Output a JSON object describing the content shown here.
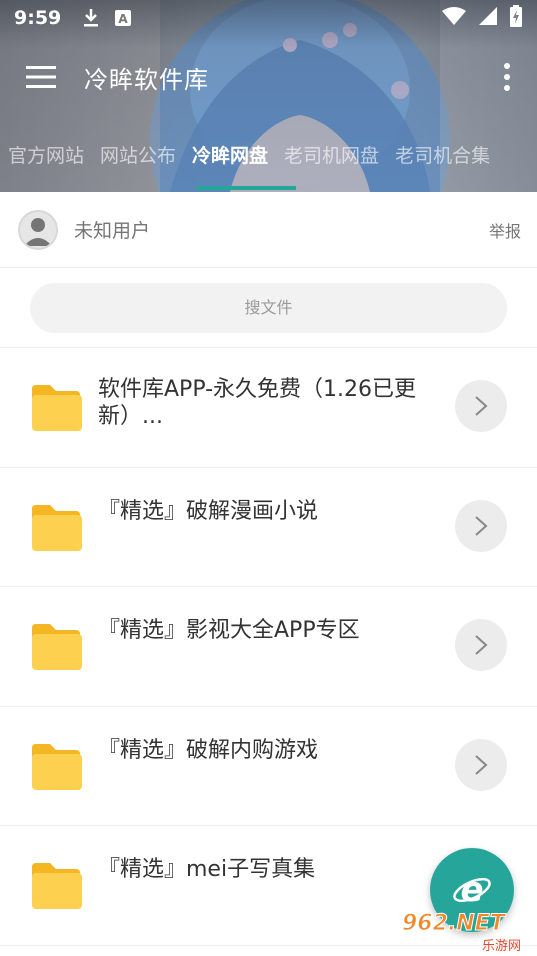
{
  "status_bar": {
    "time": "9:59"
  },
  "app_bar": {
    "title": "冷眸软件库"
  },
  "tabs": [
    {
      "label": "官方网站",
      "active": false
    },
    {
      "label": "网站公布",
      "active": false
    },
    {
      "label": "冷眸网盘",
      "active": true
    },
    {
      "label": "老司机网盘",
      "active": false
    },
    {
      "label": "老司机合集",
      "active": false
    }
  ],
  "user": {
    "name": "未知用户",
    "report_label": "举报"
  },
  "search": {
    "placeholder": "搜文件"
  },
  "files": [
    {
      "title": "软件库APP-永久免费（1.26已更新）..."
    },
    {
      "title": "『精选』破解漫画小说"
    },
    {
      "title": "『精选』影视大全APP专区"
    },
    {
      "title": "『精选』破解内购游戏"
    },
    {
      "title": "『精选』mei子写真集"
    }
  ],
  "watermark": {
    "top": "962.NET",
    "bottom": "乐游网"
  },
  "colors": {
    "accent": "#26a69a",
    "folder": "#fdd04f",
    "folder_tab": "#f5b623"
  }
}
